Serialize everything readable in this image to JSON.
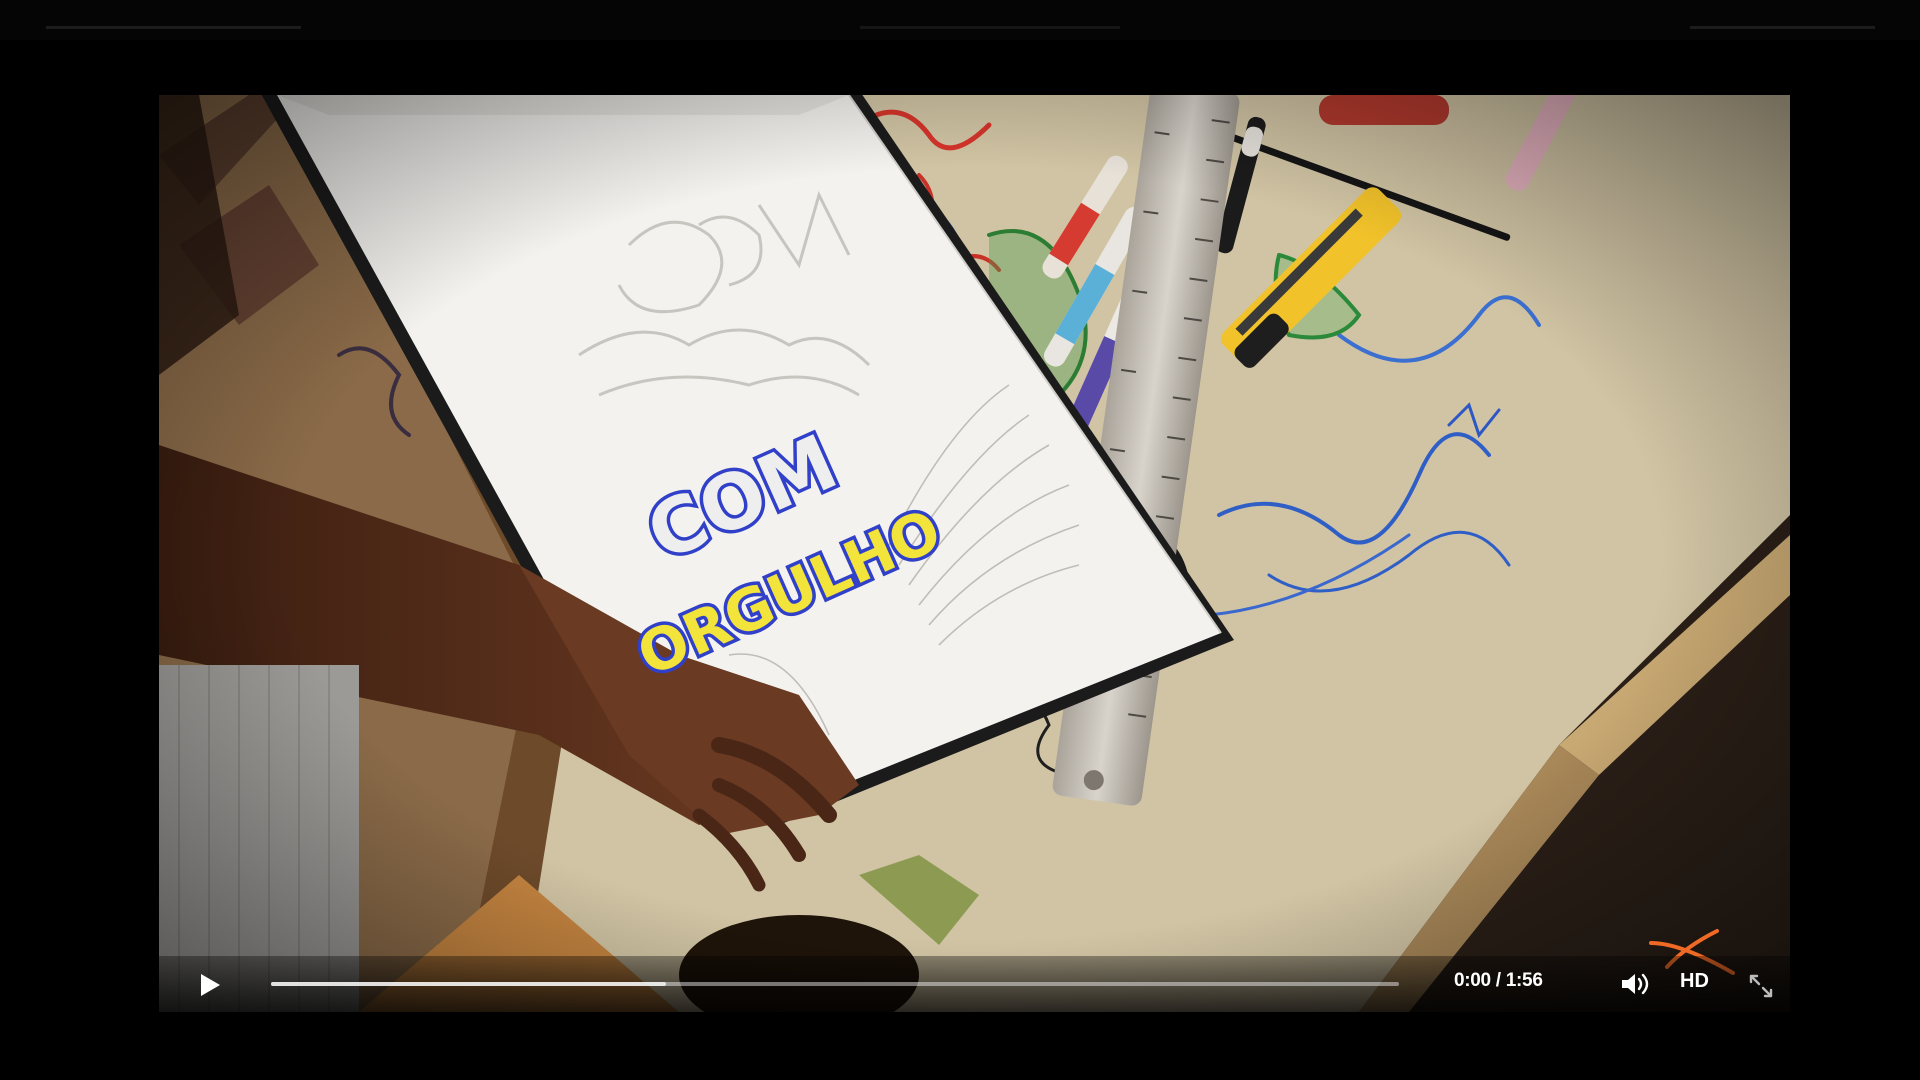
{
  "player": {
    "current_time": "0:00",
    "separator": " / ",
    "duration": "1:56",
    "quality_label": "HD",
    "progress_played": 0.0,
    "progress_buffered": 0.35
  },
  "video_frame": {
    "notebook_lettering_line1": "COM",
    "notebook_lettering_line2": "ORGULHO"
  },
  "icons": {
    "play": "play-icon",
    "volume": "volume-icon",
    "fullscreen": "fullscreen-icon",
    "logo": "brand-logo-mark"
  },
  "colors": {
    "lettering_fill": "#f2e43a",
    "lettering_outline": "#3140c8",
    "background": "#000000",
    "controls_text": "#ffffff"
  }
}
